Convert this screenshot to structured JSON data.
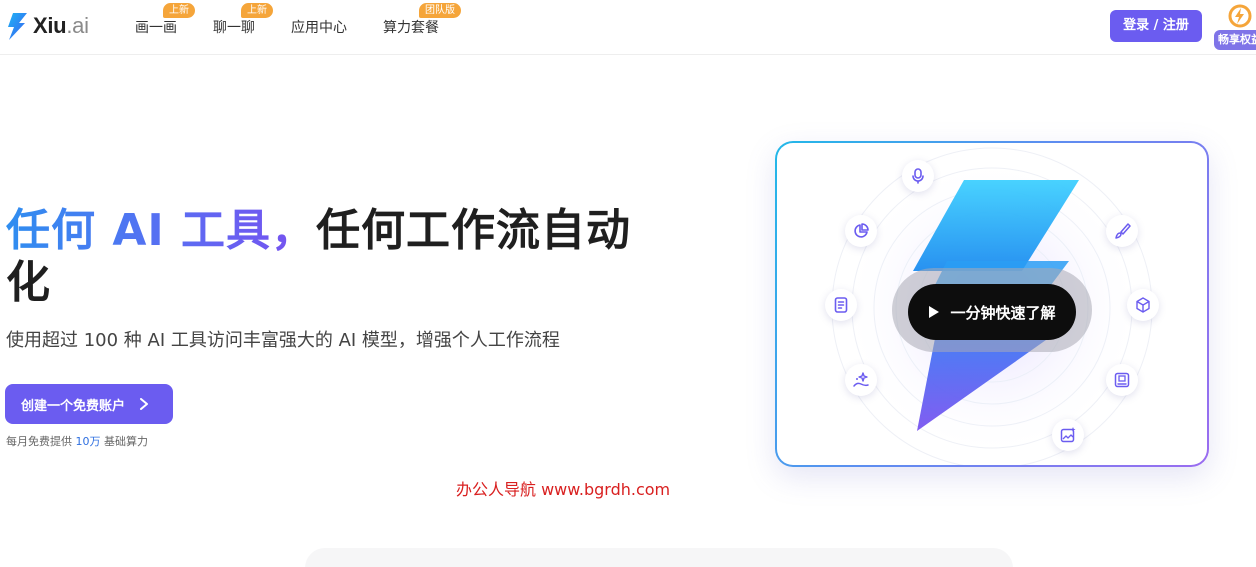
{
  "header": {
    "logo": {
      "brand": "Xiu",
      "suffix": ".ai",
      "icon": "lightning-logo-icon"
    },
    "nav": [
      {
        "label": "画一画",
        "badge": "上新"
      },
      {
        "label": "聊一聊",
        "badge": "上新"
      },
      {
        "label": "应用中心",
        "badge": ""
      },
      {
        "label": "算力套餐",
        "badge": "团队版"
      }
    ],
    "login_label": "登录 / 注册",
    "vip_label": "畅享权益",
    "vip_icon": "lightning-bolt-icon"
  },
  "hero": {
    "title_highlight": "任何 AI 工具，",
    "title_rest": "任何工作流自动化",
    "subtitle": "使用超过 100 种 AI 工具访问丰富强大的 AI 模型，增强个人工作流程",
    "cta_label": "创建一个免费账户",
    "quota_prefix": "每月免费提供",
    "quota_value": "10万",
    "quota_suffix": "基础算力"
  },
  "video_card": {
    "play_label": "一分钟快速了解",
    "icons": [
      "microphone-icon",
      "chart-pie-icon",
      "document-icon",
      "sparkles-icon",
      "brush-icon",
      "cube-icon",
      "image-frame-icon",
      "image-sparkle-icon"
    ]
  },
  "watermark": "办公人导航 www.bgrdh.com",
  "colors": {
    "primary": "#6b5cf0",
    "badge": "#f5a53a",
    "highlight_start": "#2f8ef0",
    "highlight_end": "#7a4ff0",
    "watermark": "#d92020"
  }
}
